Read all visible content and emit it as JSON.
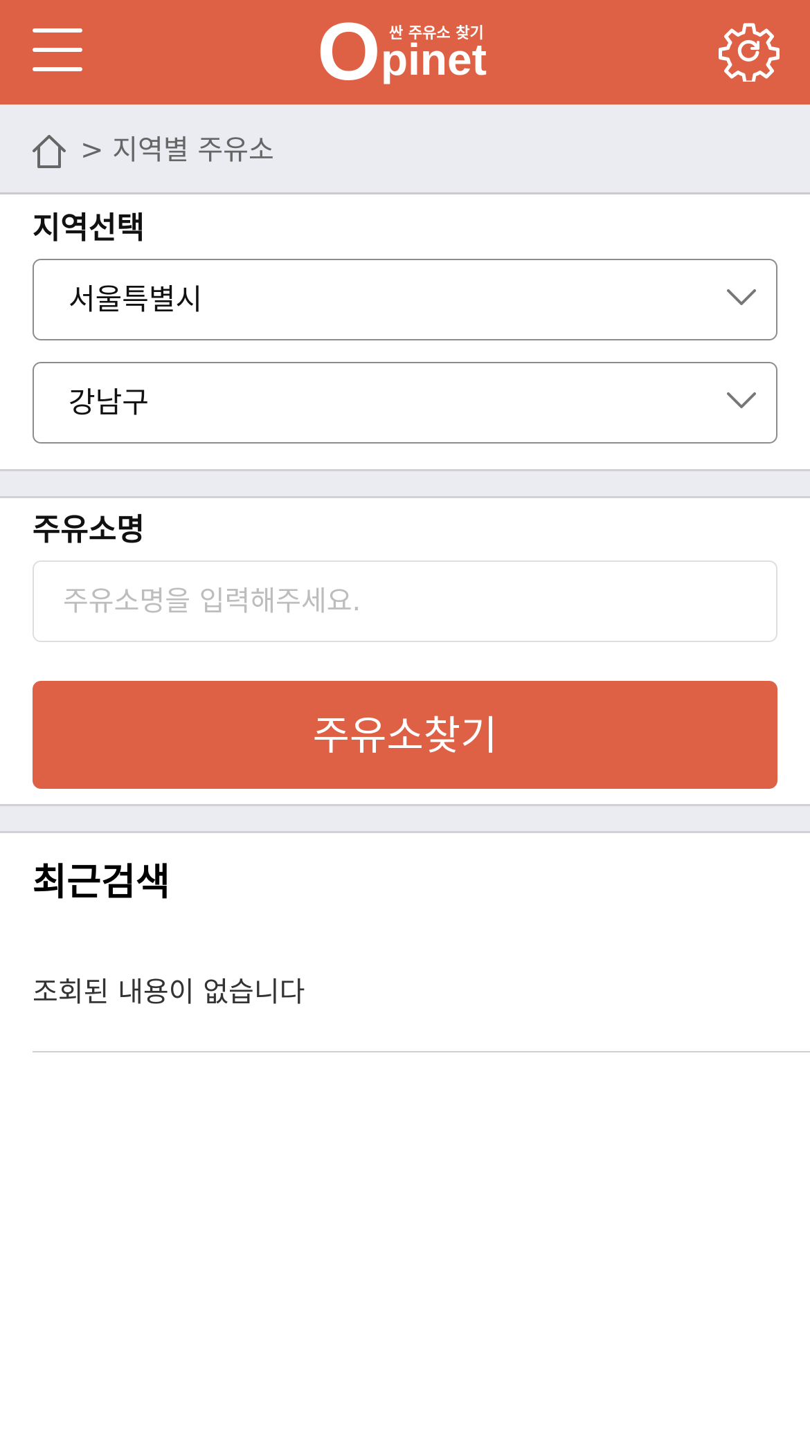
{
  "header": {
    "logo_letter": "O",
    "logo_text": "pinet",
    "logo_tagline": "싼 주유소 찾기",
    "menu_icon": "hamburger-menu-icon",
    "settings_icon": "gear-icon",
    "background_color": "#de6045"
  },
  "breadcrumb": {
    "home_icon": "home-icon",
    "text": "> 지역별 주유소"
  },
  "region": {
    "label": "지역선택",
    "city_select": {
      "value": "서울특별시"
    },
    "district_select": {
      "value": "강남구"
    }
  },
  "station_name": {
    "label": "주유소명",
    "placeholder": "주유소명을 입력해주세요.",
    "value": ""
  },
  "search_button": {
    "label": "주유소찾기",
    "color": "#de6045"
  },
  "recent": {
    "title": "최근검색",
    "empty_message": "조회된 내용이 없습니다"
  }
}
